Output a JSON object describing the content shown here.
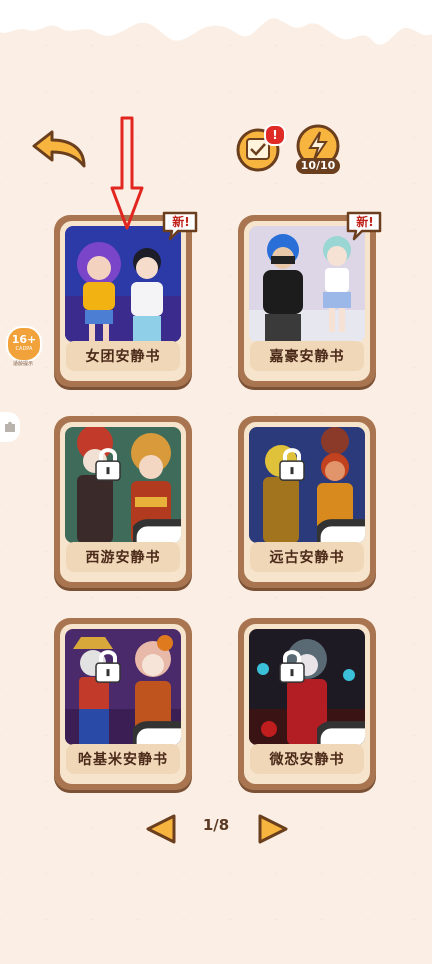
{
  "header": {
    "back_icon": "back-arrow-icon",
    "calendar_icon": "calendar-check-icon",
    "calendar_badge": "!",
    "energy_icon": "energy-video-icon",
    "energy_count": "10/10"
  },
  "side": {
    "age_badge": "16+",
    "age_caption": "CADPA",
    "age_small": "适龄提示",
    "puzzle_icon": "puzzle-icon"
  },
  "overlay": {
    "arrow_icon": "red-down-arrow-icon"
  },
  "cards": [
    {
      "label": "女团安静书",
      "new_tag": "新!",
      "locked": false
    },
    {
      "label": "嘉豪安静书",
      "new_tag": "新!",
      "locked": false
    },
    {
      "label": "西游安静书",
      "new_tag": "",
      "locked": true
    },
    {
      "label": "远古安静书",
      "new_tag": "",
      "locked": true
    },
    {
      "label": "哈基米安静书",
      "new_tag": "",
      "locked": true
    },
    {
      "label": "微恐安静书",
      "new_tag": "",
      "locked": true
    }
  ],
  "pager": {
    "text": "1/8",
    "prev_icon": "prev-arrow-icon",
    "next_icon": "next-arrow-icon"
  },
  "colors": {
    "accent": "#f4a53a",
    "frame": "#a87550",
    "label_bg": "#f0d7b8",
    "text": "#4a2a18",
    "arrow_red": "#e0261f"
  }
}
